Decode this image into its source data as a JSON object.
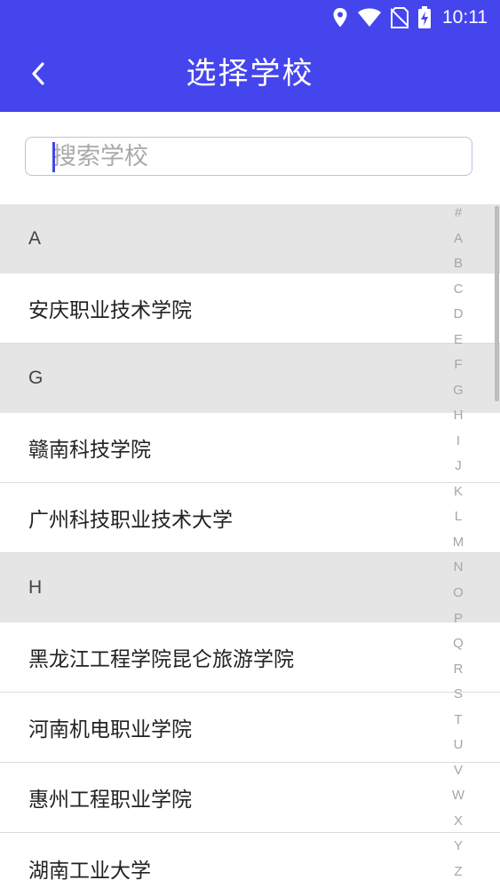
{
  "status_bar": {
    "time": "10:11",
    "icons": [
      "location-icon",
      "wifi-icon",
      "no-sim-icon",
      "battery-charging-icon"
    ]
  },
  "header": {
    "title": "选择学校",
    "back_icon": "chevron-left-icon"
  },
  "search": {
    "placeholder": "搜索学校",
    "value": ""
  },
  "list": [
    {
      "type": "header",
      "label": "A"
    },
    {
      "type": "item",
      "label": "安庆职业技术学院"
    },
    {
      "type": "header",
      "label": "G"
    },
    {
      "type": "item",
      "label": "赣南科技学院"
    },
    {
      "type": "item",
      "label": "广州科技职业技术大学"
    },
    {
      "type": "header",
      "label": "H"
    },
    {
      "type": "item",
      "label": "黑龙江工程学院昆仑旅游学院"
    },
    {
      "type": "item",
      "label": "河南机电职业学院"
    },
    {
      "type": "item",
      "label": "惠州工程职业学院"
    },
    {
      "type": "item",
      "label": "湖南工业大学"
    }
  ],
  "alphabet_index": [
    "#",
    "A",
    "B",
    "C",
    "D",
    "E",
    "F",
    "G",
    "H",
    "I",
    "J",
    "K",
    "L",
    "M",
    "N",
    "O",
    "P",
    "Q",
    "R",
    "S",
    "T",
    "U",
    "V",
    "W",
    "X",
    "Y",
    "Z"
  ],
  "colors": {
    "accent": "#4545ee",
    "section_header_bg": "#e5e5e5",
    "index_text": "#a6a6a6"
  }
}
